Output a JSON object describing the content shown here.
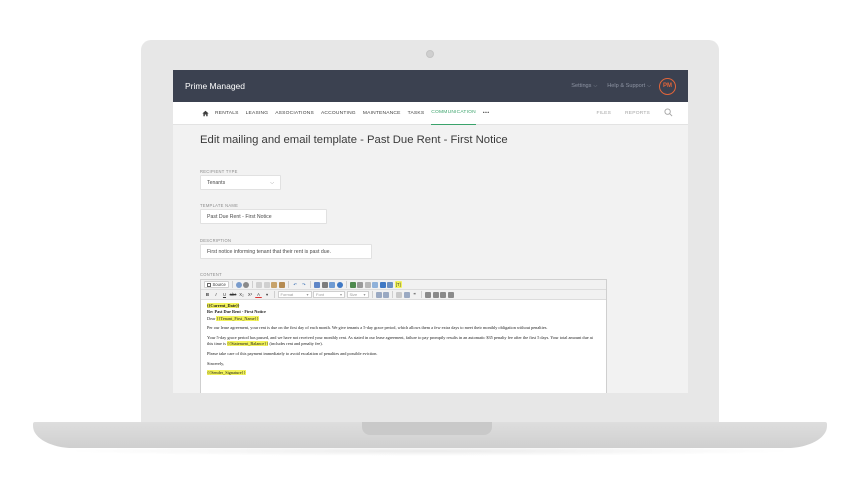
{
  "app": {
    "brand": "Prime Managed"
  },
  "topbar": {
    "settings_label": "Settings",
    "help_label": "Help & Support",
    "avatar_initials": "PM",
    "avatar_color": "#e2653a",
    "bar_color": "#3b4150"
  },
  "nav": {
    "items": [
      "RENTALS",
      "LEASING",
      "ASSOCIATIONS",
      "ACCOUNTING",
      "MAINTENANCE",
      "TASKS",
      "COMMUNICATION"
    ],
    "active": "COMMUNICATION",
    "more": "•••",
    "right": [
      "FILES",
      "REPORTS"
    ],
    "accent_color": "#3aa36b"
  },
  "page": {
    "title": "Edit mailing and email template - Past Due Rent - First Notice"
  },
  "form": {
    "recipient_type": {
      "label": "RECIPIENT TYPE",
      "value": "Tenants"
    },
    "template_name": {
      "label": "TEMPLATE NAME",
      "value": "Past Due Rent - First Notice"
    },
    "description": {
      "label": "DESCRIPTION",
      "value": "First notice informing tenant that their rent is past due."
    },
    "content": {
      "label": "CONTENT"
    }
  },
  "editor": {
    "source_label": "Source",
    "format_label": "Format",
    "font_label": "Font",
    "size_label": "Size",
    "bold": "B",
    "italic": "I",
    "underline": "U",
    "strike": "abc",
    "subscript": "X₂",
    "superscript": "X²",
    "text_color": "A",
    "tag_button": "[T]",
    "doc": {
      "date_tag": "{{Current_Date}}",
      "subject": "Re: Past Due Rent - First Notice",
      "dear": "Dear",
      "first_name_tag": "{{Tenant_First_Name}}",
      "para1": "Per our lease agreement, your rent is due on the first day of each month. We give tenants a 5-day grace period, which allows them a few extra days to meet their monthly obligation without penalties.",
      "para2_a": "Your 5-day grace period has passed, and we have not received your monthly rent. As stated in our lease agreement, failure to pay promptly results in an automatic $35 penalty fee after the first 5 days. Your total amount due at this time is",
      "balance_tag": "{{Statement_Balance}}",
      "para2_b": "(includes rent and penalty fee).",
      "para3": "Please take care of this payment immediately to avoid escalation of penalties and possible eviction.",
      "closing": "Sincerely,",
      "signature_tag": "{{Sender_Signature}}"
    }
  }
}
